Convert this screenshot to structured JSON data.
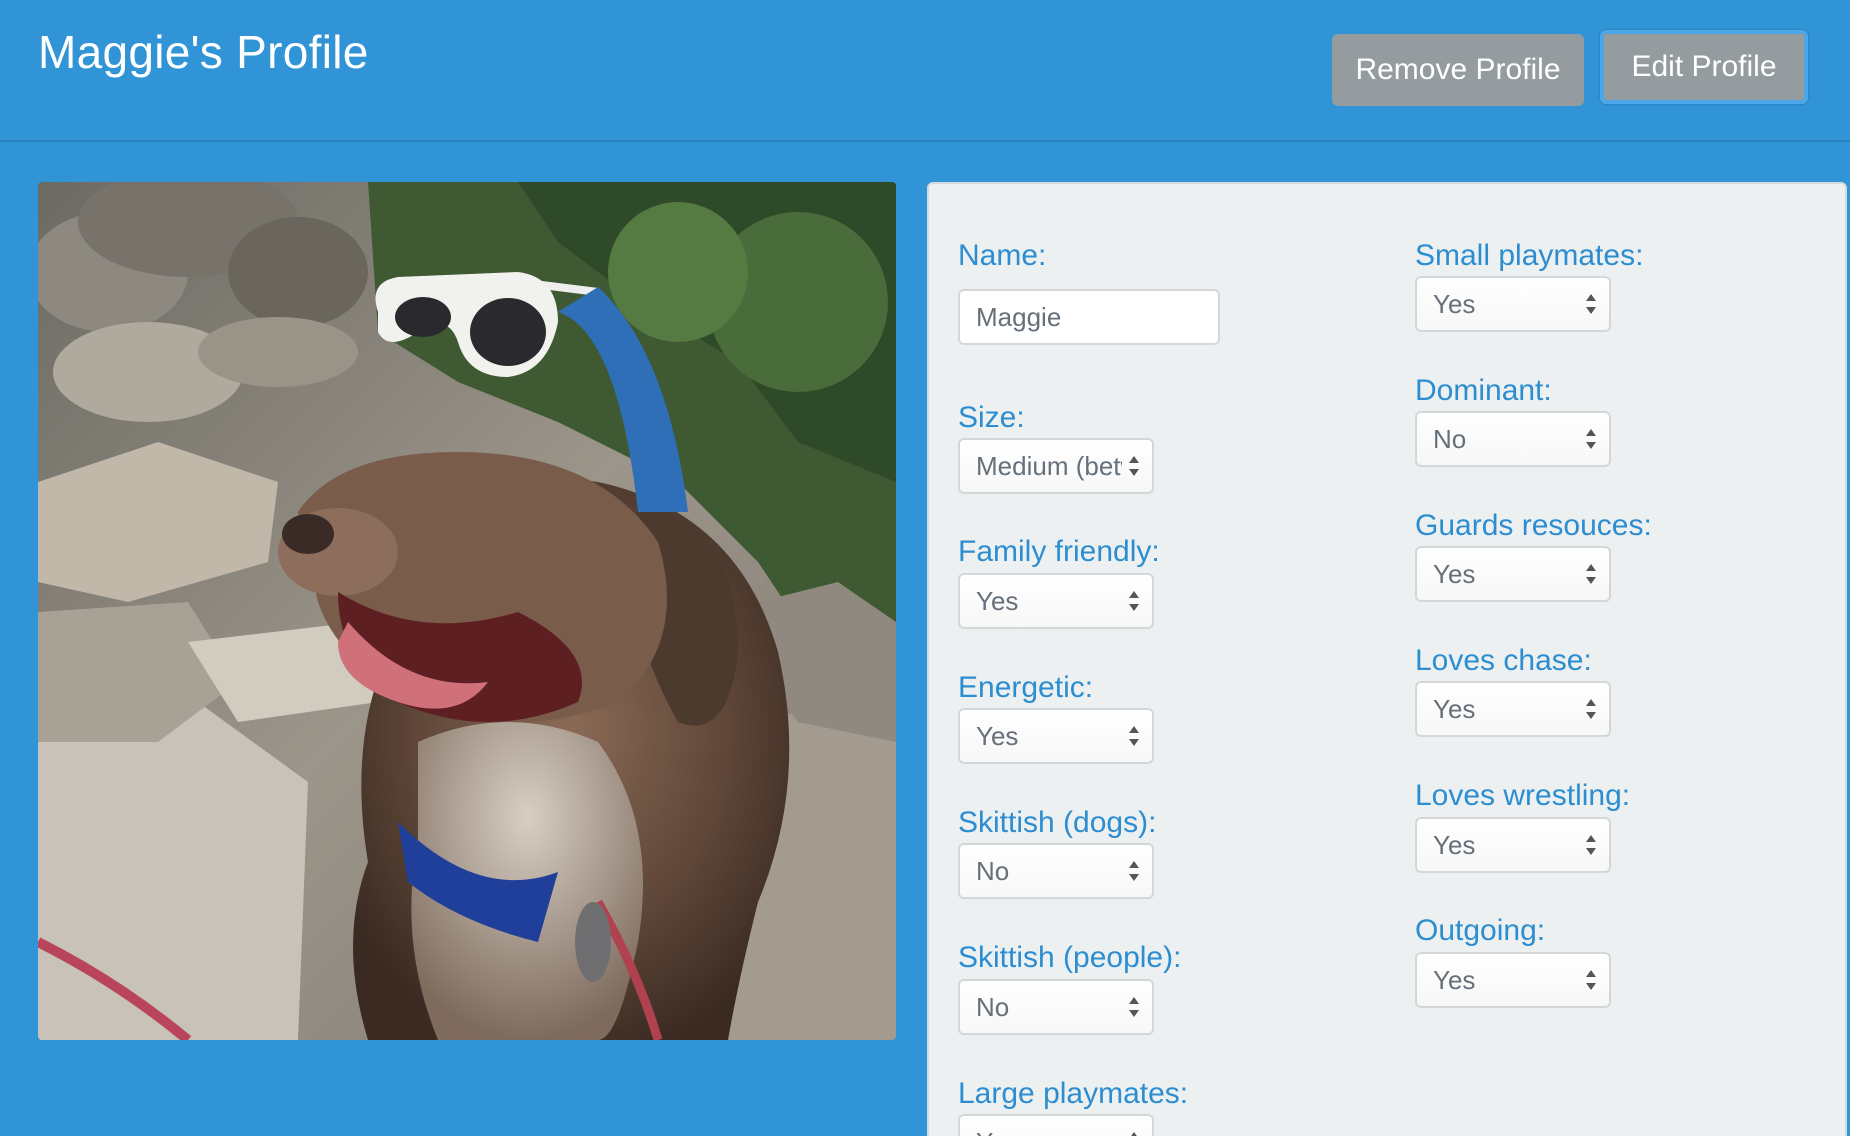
{
  "header": {
    "title": "Maggie's Profile",
    "remove_button": "Remove Profile",
    "edit_button": "Edit Profile"
  },
  "photo": {
    "description_icon": "dog-photo"
  },
  "form": {
    "left": [
      {
        "label": "Name:",
        "type": "text",
        "value": "Maggie"
      },
      {
        "label": "Size:",
        "type": "select",
        "value": "Medium (betw"
      },
      {
        "label": "Family friendly:",
        "type": "select",
        "value": "Yes"
      },
      {
        "label": "Energetic:",
        "type": "select",
        "value": "Yes"
      },
      {
        "label": "Skittish (dogs):",
        "type": "select",
        "value": "No"
      },
      {
        "label": "Skittish (people):",
        "type": "select",
        "value": "No"
      },
      {
        "label": "Large playmates:",
        "type": "select",
        "value": "Yes"
      }
    ],
    "right": [
      {
        "label": "Small playmates:",
        "type": "select",
        "value": "Yes"
      },
      {
        "label": "Dominant:",
        "type": "select",
        "value": "No"
      },
      {
        "label": "Guards resouces:",
        "type": "select",
        "value": "Yes"
      },
      {
        "label": "Loves chase:",
        "type": "select",
        "value": "Yes"
      },
      {
        "label": "Loves wrestling:",
        "type": "select",
        "value": "Yes"
      },
      {
        "label": "Outgoing:",
        "type": "select",
        "value": "Yes"
      }
    ]
  },
  "colors": {
    "background": "#3094d6",
    "panel": "#edf0f1",
    "label": "#2c8dd0",
    "button": "#949ca0"
  }
}
